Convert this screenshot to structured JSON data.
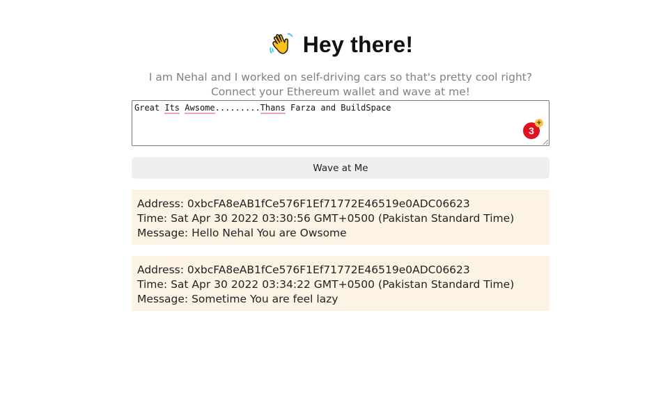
{
  "header": {
    "emoji_icon": "waving-hand-icon",
    "title": "Hey there!"
  },
  "bio": "I am Nehal and I worked on self-driving cars so that's pretty cool right? Connect your Ethereum wallet and wave at me!",
  "message_input": {
    "value_parts": [
      "Great ",
      "Its",
      " ",
      "Awsome",
      ".........",
      "Thans",
      " Farza and BuildSpace"
    ],
    "grammar_badge_count": "3"
  },
  "wave_button": {
    "label": "Wave at Me"
  },
  "waves": [
    {
      "address": "Address: 0xbcFA8eAB1fCe576F1Ef71772E46519e0ADC06623",
      "time": "Time: Sat Apr 30 2022 03:30:56 GMT+0500 (Pakistan Standard Time)",
      "message": "Message: Hello Nehal You are Owsome"
    },
    {
      "address": "Address: 0xbcFA8eAB1fCe576F1Ef71772E46519e0ADC06623",
      "time": "Time: Sat Apr 30 2022 03:34:22 GMT+0500 (Pakistan Standard Time)",
      "message": "Message: Sometime You are feel lazy"
    }
  ],
  "colors": {
    "card_background": "#fdf3e5",
    "button_background": "#efefef",
    "bio_text": "#808080",
    "badge": "#e2111f"
  }
}
